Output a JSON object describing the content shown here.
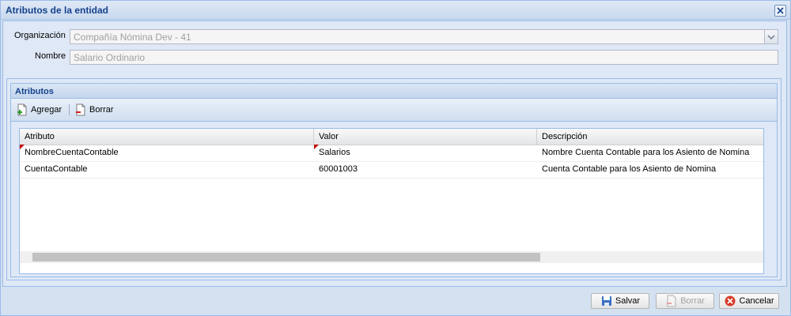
{
  "window": {
    "title": "Atributos de la entidad"
  },
  "form": {
    "organizacion_label": "Organización",
    "organizacion_value": "Compañía Nómina Dev - 41",
    "nombre_label": "Nombre",
    "nombre_value": "Salario Ordinario"
  },
  "panel": {
    "title": "Atributos",
    "toolbar": {
      "add_label": "Agregar",
      "delete_label": "Borrar"
    }
  },
  "grid": {
    "columns": [
      "Atributo",
      "Valor",
      "Descripción"
    ],
    "rows": [
      {
        "atributo": "NombreCuentaContable",
        "valor": "Salarios",
        "descripcion": "Nombre Cuenta Contable para los Asiento de Nomina"
      },
      {
        "atributo": "CuentaContable",
        "valor": "60001003",
        "descripcion": "Cuenta Contable para los Asiento de Nomina"
      }
    ]
  },
  "footer": {
    "save_label": "Salvar",
    "delete_label": "Borrar",
    "cancel_label": "Cancelar"
  },
  "colors": {
    "title": "#15428b",
    "border": "#99bbe8",
    "dirty_marker": "#c00000"
  },
  "icons": {
    "close": "close-icon",
    "add": "add-document-icon",
    "delete": "delete-document-icon",
    "save": "save-icon",
    "cancel": "cancel-icon"
  }
}
